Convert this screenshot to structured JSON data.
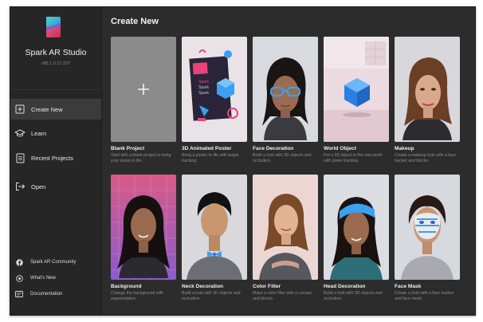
{
  "app": {
    "name": "Spark AR Studio",
    "version": "v85.1.0.17.237"
  },
  "nav": [
    {
      "label": "Create New",
      "icon": "create-new-icon",
      "active": true
    },
    {
      "label": "Learn",
      "icon": "graduation-cap-icon",
      "active": false
    },
    {
      "label": "Recent Projects",
      "icon": "document-icon",
      "active": false
    },
    {
      "label": "Open",
      "icon": "open-arrow-icon",
      "active": false
    }
  ],
  "footer": [
    {
      "label": "Spark AR Community",
      "icon": "facebook-icon"
    },
    {
      "label": "What's New",
      "icon": "spark-icon"
    },
    {
      "label": "Documentation",
      "icon": "book-icon"
    }
  ],
  "main": {
    "title": "Create New",
    "templates": [
      {
        "title": "Blank Project",
        "desc": "Start with a blank project to bring your vision to life."
      },
      {
        "title": "3D Animated Poster",
        "desc": "Bring a poster to life with target tracking."
      },
      {
        "title": "Face Decoration",
        "desc": "Build a look with 3D objects and occluders."
      },
      {
        "title": "World Object",
        "desc": "Put a 3D object in the real world with plane tracking."
      },
      {
        "title": "Makeup",
        "desc": "Create a makeup look with a face tracker and blocks."
      },
      {
        "title": "Background",
        "desc": "Change the background with segmentation."
      },
      {
        "title": "Neck Decoration",
        "desc": "Build a look with 3D objects and occluders."
      },
      {
        "title": "Color Filter",
        "desc": "Make a color filter with a canvas and blocks."
      },
      {
        "title": "Head Decoration",
        "desc": "Build a look with 3D objects and occluders."
      },
      {
        "title": "Face Mask",
        "desc": "Create a look with a face tracker and face mesh."
      }
    ]
  },
  "poster_text": [
    "Spark",
    "Spark",
    "Spark"
  ],
  "colors": {
    "accent_pink": "#e8447a",
    "accent_blue": "#3aa0f0",
    "background": "#2c2c2c",
    "sidebar": "#262626"
  }
}
